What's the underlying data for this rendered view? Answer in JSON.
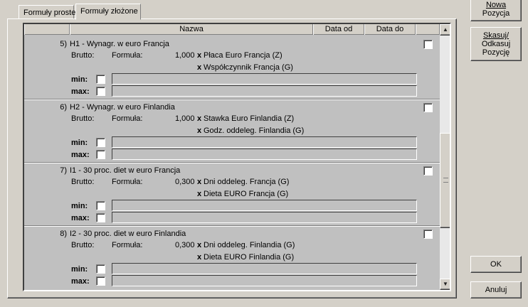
{
  "tabs": [
    {
      "label": "Formuły proste"
    },
    {
      "label": "Formuły złożone"
    }
  ],
  "grid": {
    "columns": {
      "name": "Nazwa",
      "date_from": "Data od",
      "date_to": "Data do"
    },
    "labels": {
      "brutto": "Brutto:",
      "formula": "Formuła:",
      "min": "min:",
      "max": "max:"
    },
    "entries": [
      {
        "num": "5)",
        "title": "H1 - Wynagr. w euro Francja",
        "coef": "1,000",
        "op1": "x",
        "term1": "Płaca Euro Francja (Z)",
        "op2": "x",
        "term2": "Współczynnik Francja (G)"
      },
      {
        "num": "6)",
        "title": "H2 - Wynagr. w euro Finlandia",
        "coef": "1,000",
        "op1": "x",
        "term1": "Stawka Euro Finlandia (Z)",
        "op2": "x",
        "term2": "Godz. oddeleg. Finlandia (G)"
      },
      {
        "num": "7)",
        "title": "I1 - 30 proc. diet w euro Francja",
        "coef": "0,300",
        "op1": "x",
        "term1": "Dni oddeleg. Francja (G)",
        "op2": "x",
        "term2": "Dieta EURO Francja (G)"
      },
      {
        "num": "8)",
        "title": "I2 - 30 proc. diet w euro Finlandia",
        "coef": "0,300",
        "op1": "x",
        "term1": "Dni oddeleg. Finlandia (G)",
        "op2": "x",
        "term2": "Dieta EURO Finlandia (G)"
      }
    ]
  },
  "buttons": {
    "new_line1": "Nowa",
    "new_line2": "Pozycja",
    "del_line1": "Skasuj/",
    "del_line2": "Odkasuj",
    "del_line3": "Pozycję",
    "ok": "OK",
    "cancel": "Anuluj"
  }
}
